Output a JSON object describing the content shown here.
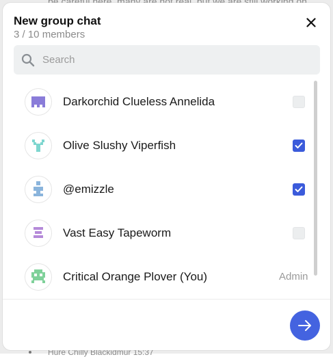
{
  "background": {
    "top_text": "be careful here, many are not real, but we are still working on",
    "bottom_text": "Hure Chilly Blackidmur 15:37"
  },
  "dialog": {
    "title": "New group chat",
    "member_count": "3 / 10 members",
    "close_icon": "close-icon"
  },
  "search": {
    "placeholder": "Search",
    "value": "",
    "icon": "search-icon"
  },
  "members": [
    {
      "name": "Darkorchid Clueless Annelida",
      "checked": false,
      "avatar_color": "#8a7cd9"
    },
    {
      "name": "Olive Slushy Viperfish",
      "checked": true,
      "avatar_color": "#7ed6cf"
    },
    {
      "name": "@emizzle",
      "checked": true,
      "avatar_color": "#8ab4dc"
    },
    {
      "name": "Vast Easy Tapeworm",
      "checked": false,
      "avatar_color": "#b58ad9"
    },
    {
      "name": "Critical Orange Plover (You)",
      "role": "Admin",
      "avatar_color": "#7fd19a"
    }
  ],
  "footer": {
    "next_icon": "arrow-right-icon",
    "accent_color": "#4463e0"
  }
}
